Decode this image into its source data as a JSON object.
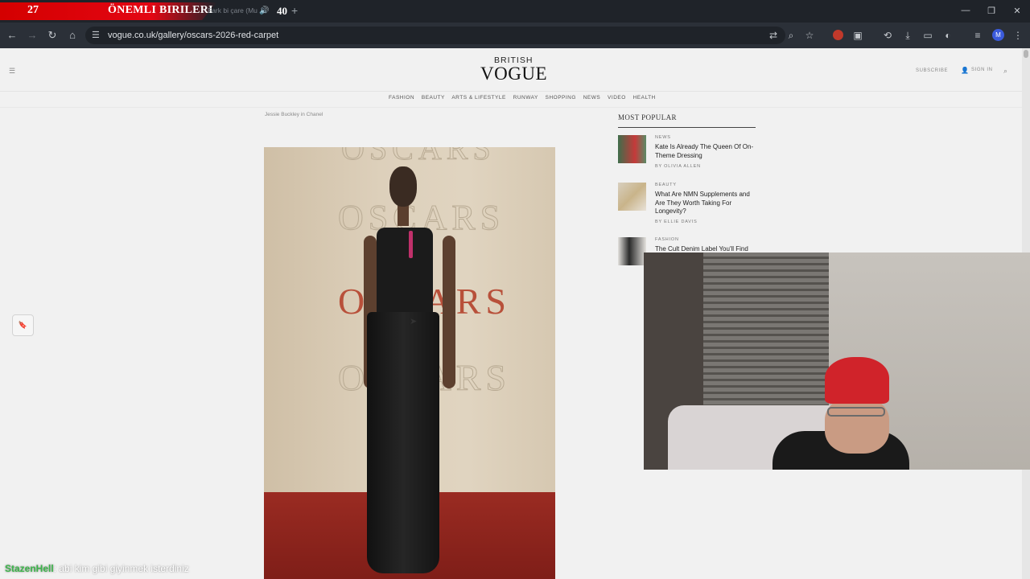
{
  "overlay": {
    "left_number": "27",
    "banner_title": "ÖNEMLI BIRILERI",
    "right_number": "40"
  },
  "tab": {
    "title": "Fark bi çare (Mu",
    "audio_icon": "speaker-icon",
    "new_tab_icon": "plus-icon"
  },
  "window": {
    "minimize_icon": "minimize-icon",
    "restore_icon": "restore-icon",
    "close_icon": "close-icon"
  },
  "toolbar": {
    "url": "vogue.co.uk/gallery/oscars-2026-red-carpet",
    "profile_initial": "M"
  },
  "site": {
    "logo_top": "BRITISH",
    "logo_main": "VOGUE",
    "subscribe": "SUBSCRIBE",
    "sign_in": "SIGN IN",
    "nav": [
      "FASHION",
      "BEAUTY",
      "ARTS & LIFESTYLE",
      "RUNWAY",
      "SHOPPING",
      "NEWS",
      "VIDEO",
      "HEALTH"
    ]
  },
  "gallery": {
    "caption": "Jessie Buckley in Chanel",
    "backdrop_word": "OSCARS"
  },
  "most_popular": {
    "title": "MOST POPULAR",
    "items": [
      {
        "category": "NEWS",
        "headline": "Kate Is Already The Queen Of On-Theme Dressing",
        "byline": "BY OLIVIA ALLEN"
      },
      {
        "category": "BEAUTY",
        "headline": "What Are NMN Supplements and Are They Worth Taking For Longevity?",
        "byline": "BY ELLIE DAVIS"
      },
      {
        "category": "FASHION",
        "headline": "The Cult Denim Label You'll Find In",
        "byline": ""
      }
    ]
  },
  "chat": {
    "username": "StazenHell",
    "message": ": abi kim gibi giyinmek isterdiniz"
  },
  "colors": {
    "banner_red": "#e30613",
    "chrome_dark": "#1f2329",
    "carpet_red": "#8a241c",
    "beanie_red": "#d0232a",
    "chat_user_green": "#3cb54a"
  }
}
